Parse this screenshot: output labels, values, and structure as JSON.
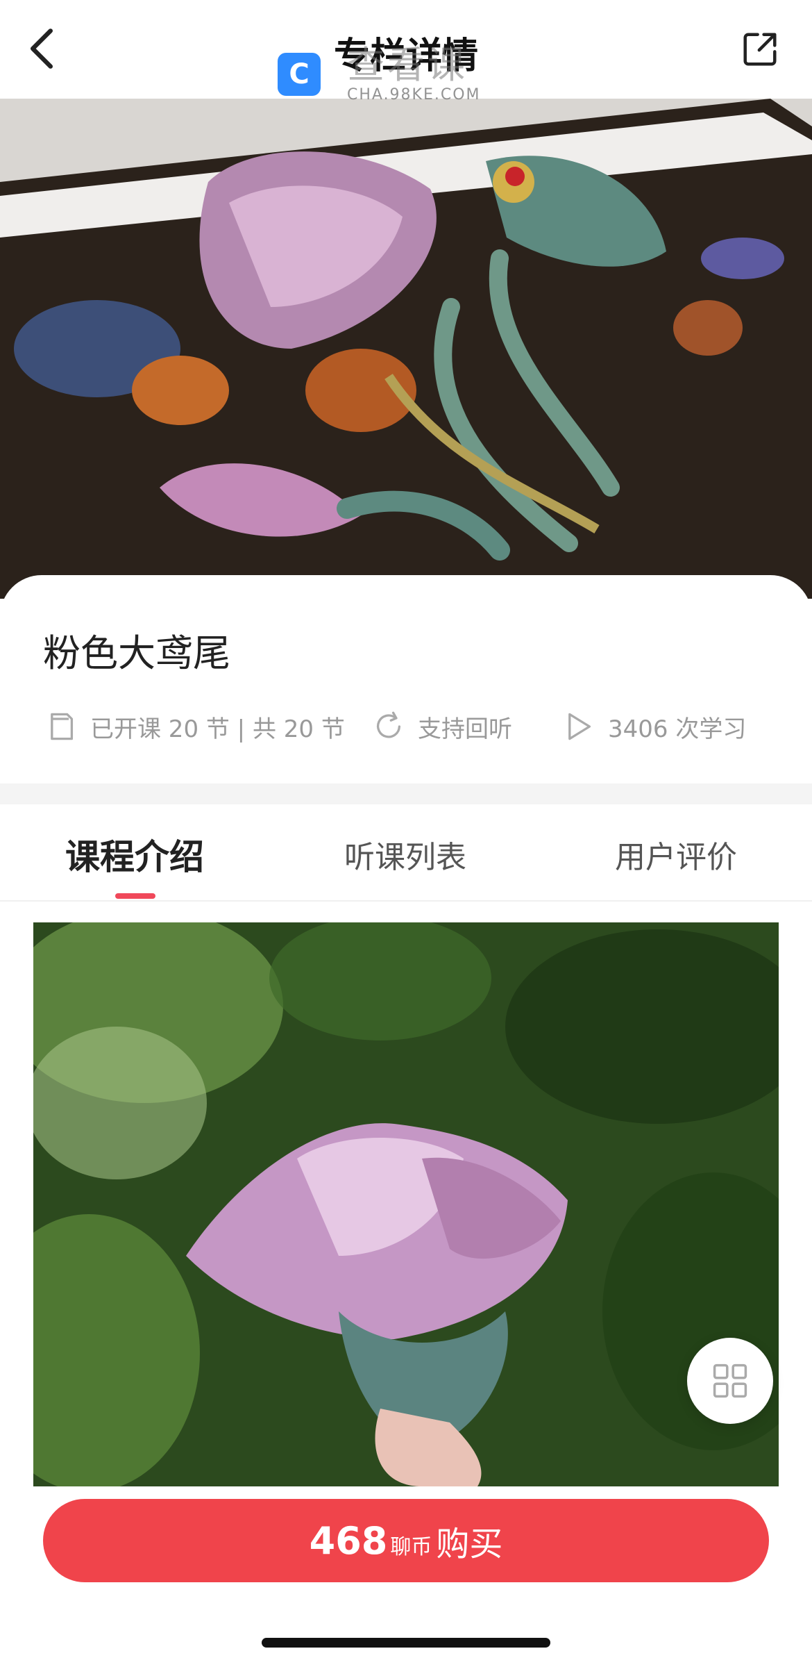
{
  "header": {
    "title": "专栏详情",
    "back_icon": "chevron-left-icon",
    "share_icon": "share-icon"
  },
  "watermark": {
    "logo_glyph": "C",
    "text": "查看课",
    "url": "CHA.98KE.COM"
  },
  "course": {
    "title": "粉色大鸢尾",
    "lessons": "已开课 20 节 | 共 20 节",
    "replay": "支持回听",
    "learners": "3406 次学习"
  },
  "tabs": [
    {
      "label": "课程介绍",
      "active": true
    },
    {
      "label": "听课列表",
      "active": false
    },
    {
      "label": "用户评价",
      "active": false
    }
  ],
  "buy": {
    "price": "468",
    "unit": "聊币",
    "label": "购买"
  },
  "colors": {
    "accent": "#f0444b",
    "tab_indicator": "#f0485a",
    "muted_text": "#999999"
  }
}
